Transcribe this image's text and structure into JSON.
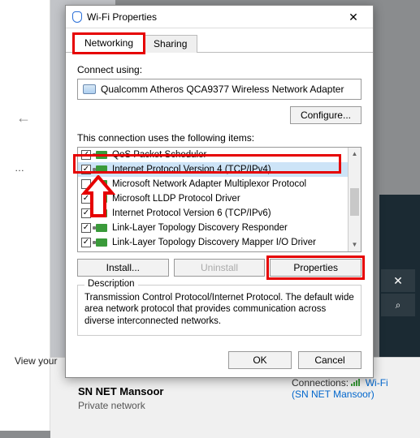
{
  "window": {
    "title": "Wi-Fi Properties"
  },
  "tabs": {
    "networking": "Networking",
    "sharing": "Sharing"
  },
  "connect_using_label": "Connect using:",
  "adapter": "Qualcomm Atheros QCA9377 Wireless Network Adapter",
  "configure_btn": "Configure...",
  "items_label": "This connection uses the following items:",
  "items": [
    {
      "checked": true,
      "label": "QoS Packet Scheduler",
      "selected": false
    },
    {
      "checked": true,
      "label": "Internet Protocol Version 4 (TCP/IPv4)",
      "selected": true
    },
    {
      "checked": false,
      "label": "Microsoft Network Adapter Multiplexor Protocol",
      "selected": false
    },
    {
      "checked": true,
      "label": "Microsoft LLDP Protocol Driver",
      "selected": false
    },
    {
      "checked": true,
      "label": "Internet Protocol Version 6 (TCP/IPv6)",
      "selected": false
    },
    {
      "checked": true,
      "label": "Link-Layer Topology Discovery Responder",
      "selected": false
    },
    {
      "checked": true,
      "label": "Link-Layer Topology Discovery Mapper I/O Driver",
      "selected": false
    }
  ],
  "btns": {
    "install": "Install...",
    "uninstall": "Uninstall",
    "properties": "Properties"
  },
  "desc": {
    "legend": "Description",
    "text": "Transmission Control Protocol/Internet Protocol. The default wide area network protocol that provides communication across diverse interconnected networks."
  },
  "ok": "OK",
  "cancel": "Cancel",
  "bg": {
    "view_your": "View your",
    "network_name": "SN NET Mansoor",
    "network_type": "Private network",
    "connections_label": "Connections:",
    "connection_link": "Wi-Fi (SN NET Mansoor)"
  }
}
